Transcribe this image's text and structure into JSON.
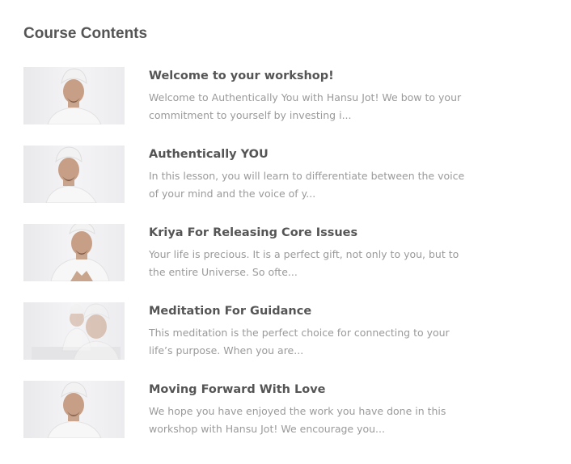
{
  "section": {
    "title": "Course Contents"
  },
  "lessons": [
    {
      "title": "Welcome to your workshop!",
      "description": "Welcome to Authentically You with Hansu Jot! We bow to your commitment to yourself by investing i..."
    },
    {
      "title": "Authentically YOU",
      "description": "In this lesson, you will learn to differentiate between the voice of your mind and the voice of y..."
    },
    {
      "title": "Kriya For Releasing Core Issues",
      "description": "Your life is precious. It is a perfect gift, not only to you, but to the entire Universe. So ofte..."
    },
    {
      "title": "Meditation For Guidance",
      "description": "This meditation is the perfect choice for connecting to your life’s purpose. When you are..."
    },
    {
      "title": "Moving Forward With Love",
      "description": "We hope you have enjoyed the work you have done in this workshop with Hansu Jot! We encourage you..."
    }
  ],
  "colors": {
    "heading": "#555555",
    "title": "#555555",
    "description": "#9a9a9a",
    "thumb_bg": "#eeeef0"
  },
  "icons": {
    "thumbnail": "lesson-video-thumbnail"
  }
}
